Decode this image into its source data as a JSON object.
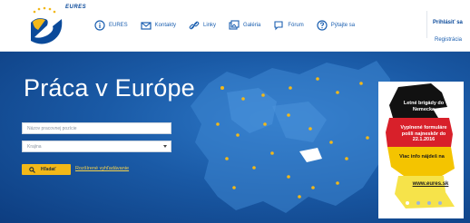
{
  "header": {
    "logo_text": "EURES",
    "nav": [
      {
        "label": "EURES",
        "icon": "info-icon"
      },
      {
        "label": "Kontakty",
        "icon": "mail-icon"
      },
      {
        "label": "Linky",
        "icon": "link-icon"
      },
      {
        "label": "Galéria",
        "icon": "gallery-icon"
      },
      {
        "label": "Fórum",
        "icon": "forum-icon"
      },
      {
        "label": "Pýtajte sa",
        "icon": "question-icon"
      }
    ],
    "login_label": "Prihlásiť sa",
    "register_label": "Registrácia"
  },
  "hero": {
    "title": "Práca v Európe",
    "job_placeholder": "Názov pracovnej pozície",
    "country_value": "Krajina",
    "search_label": "Hľadať",
    "advanced_link": "Rozšírené vyhľadávanie"
  },
  "ad": {
    "line1": "Letné brigády do Nemecka",
    "line2": "Vyplnené formuláre pošli najneskôr do 22.1.2016",
    "line3": "Viac info nájdeš na",
    "line4": "www.eures.sk"
  },
  "slider": {
    "count": 4,
    "active_index": 0
  },
  "colors": {
    "primary_blue": "#1b5fb0",
    "hero_blue": "#1a5aa6",
    "accent_yellow": "#f2b818",
    "ad_flag_black": "#111111",
    "ad_flag_red": "#d8202a",
    "ad_flag_gold": "#f4c400"
  }
}
